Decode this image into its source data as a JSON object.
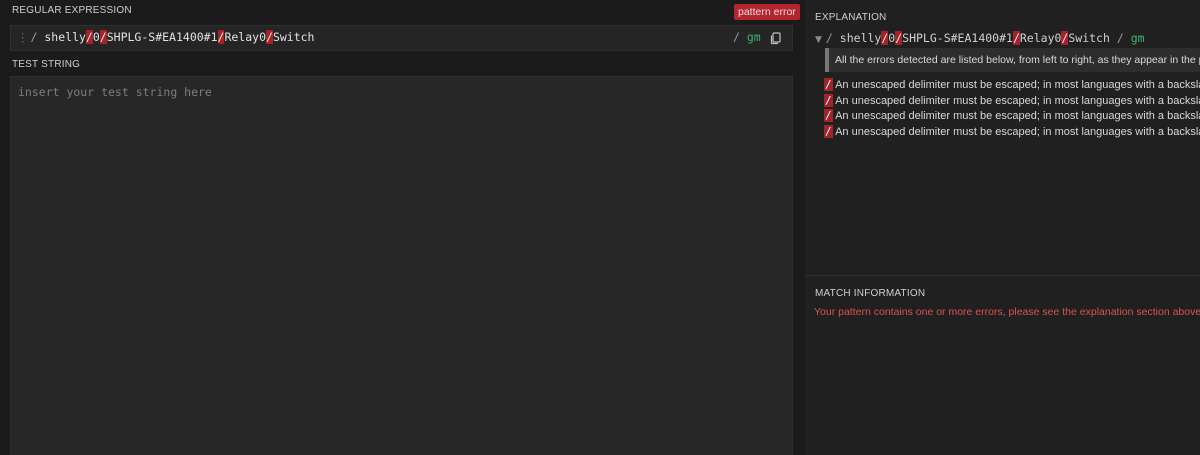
{
  "regex_section": {
    "title": "REGULAR EXPRESSION",
    "error_badge": "pattern error",
    "delimiter": "/",
    "pattern_parts": [
      "shelly",
      "/",
      "0",
      "/",
      "SHPLG-S#EA1400#1",
      "/",
      "Relay0",
      "/",
      "Switch"
    ],
    "flags": "gm"
  },
  "test_section": {
    "title": "TEST STRING",
    "placeholder": "insert your test string here"
  },
  "explanation": {
    "title": "EXPLANATION",
    "pattern_parts": [
      "shelly",
      "/",
      "0",
      "/",
      "SHPLG-S#EA1400#1",
      "/",
      "Relay0",
      "/",
      "Switch"
    ],
    "delimiter": "/",
    "flags": "gm",
    "note": "All the errors detected are listed below, from left to right, as they appear in the pattern.",
    "errors": [
      {
        "token": "/",
        "message": "An unescaped delimiter must be escaped; in most languages with a backslash",
        "badge": "\\"
      },
      {
        "token": "/",
        "message": "An unescaped delimiter must be escaped; in most languages with a backslash",
        "badge": "\\"
      },
      {
        "token": "/",
        "message": "An unescaped delimiter must be escaped; in most languages with a backslash",
        "badge": "\\"
      },
      {
        "token": "/",
        "message": "An unescaped delimiter must be escaped; in most languages with a backslash",
        "badge": "\\"
      }
    ]
  },
  "match_info": {
    "title": "MATCH INFORMATION",
    "message": "Your pattern contains one or more errors, please see the explanation section above."
  },
  "colors": {
    "error_red": "#a3232b",
    "flag_green": "#3cb371",
    "warning_text": "#d9534f",
    "backslash_badge": "#c9a227"
  },
  "icons": {
    "drag_handle": "vertical-dots-icon",
    "copy": "copy-icon",
    "collapse": "triangle-down-icon"
  }
}
